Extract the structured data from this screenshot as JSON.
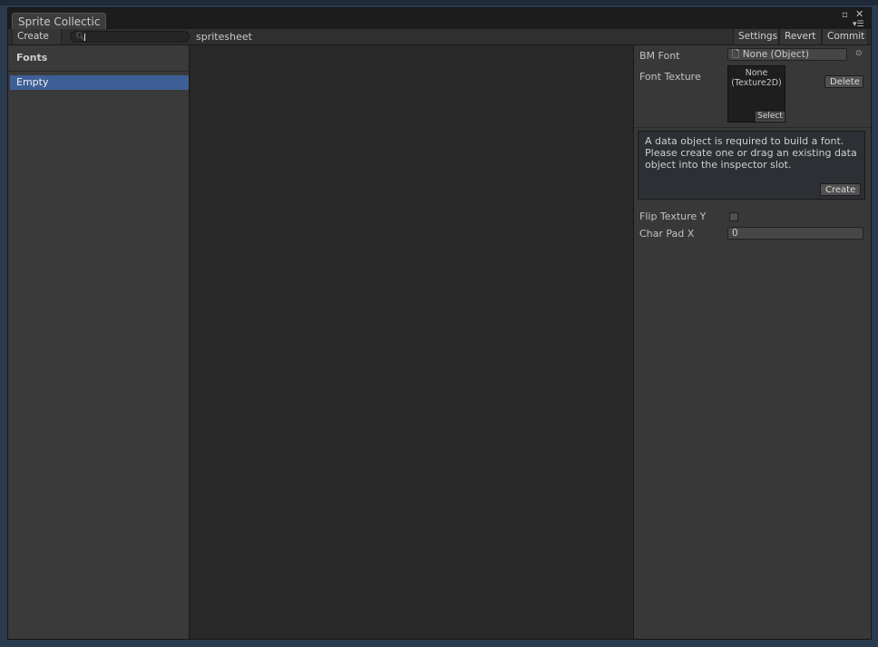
{
  "window": {
    "tab_title": "Sprite Collectic",
    "maximize_icon": "maximize-icon",
    "close_icon": "close-icon",
    "menu_icon": "menu-icon"
  },
  "toolbar": {
    "create_label": "Create ▾",
    "search_value": "",
    "sheet_name": "spritesheet",
    "settings_label": "Settings",
    "revert_label": "Revert",
    "commit_label": "Commit"
  },
  "left": {
    "header": "Fonts",
    "items": [
      {
        "label": "Empty",
        "selected": true
      }
    ]
  },
  "inspector": {
    "bm_font_label": "BM Font",
    "bm_font_value": "None (Object)",
    "font_texture_label": "Font Texture",
    "texture_slot_line1": "None",
    "texture_slot_line2": "(Texture2D)",
    "select_label": "Select",
    "delete_label": "Delete",
    "help_message": "A data object is required to build a font. Please create one or drag an existing data object into the inspector slot.",
    "create_label": "Create",
    "flip_texture_label": "Flip Texture Y",
    "flip_texture_checked": false,
    "char_pad_label": "Char Pad X",
    "char_pad_value": "0"
  },
  "colors": {
    "selection": "#3e5f96",
    "panel": "#3a3a3a",
    "center": "#282828"
  }
}
